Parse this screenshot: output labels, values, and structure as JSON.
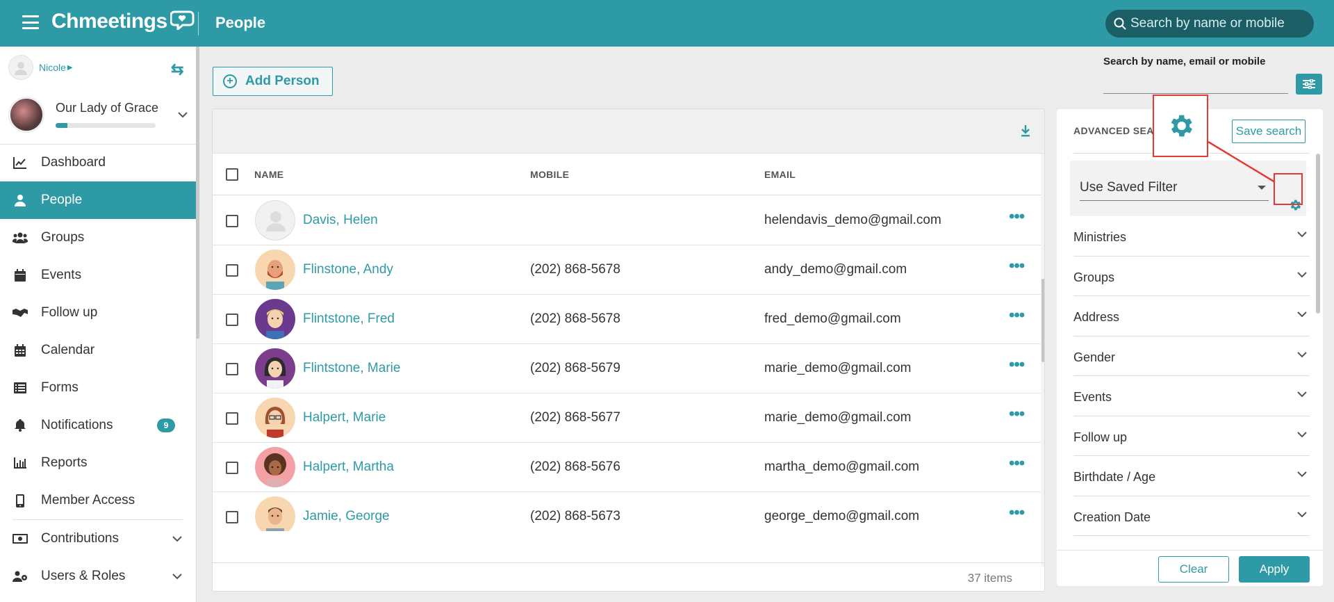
{
  "app": {
    "logo": "Chmeetings",
    "page_title": "People",
    "top_search_placeholder": "Search by name or mobile"
  },
  "sidebar": {
    "user_name": "Nicole",
    "org_name": "Our Lady of Grace",
    "org_progress": 0.12,
    "items": [
      {
        "label": "Dashboard",
        "icon": "chart-line-icon"
      },
      {
        "label": "People",
        "icon": "person-icon",
        "active": true
      },
      {
        "label": "Groups",
        "icon": "users-icon"
      },
      {
        "label": "Events",
        "icon": "calendar-icon"
      },
      {
        "label": "Follow up",
        "icon": "handshake-icon"
      },
      {
        "label": "Calendar",
        "icon": "calendar-grid-icon"
      },
      {
        "label": "Forms",
        "icon": "list-icon"
      },
      {
        "label": "Notifications",
        "icon": "bell-icon",
        "badge": "9"
      },
      {
        "label": "Reports",
        "icon": "bar-chart-icon"
      },
      {
        "label": "Member Access",
        "icon": "mobile-icon"
      },
      {
        "label": "Contributions",
        "icon": "money-icon"
      },
      {
        "label": "Users & Roles",
        "icon": "users-cog-icon"
      }
    ]
  },
  "toolbar": {
    "add_person_label": "Add Person"
  },
  "table": {
    "columns": [
      "NAME",
      "MOBILE",
      "EMAIL"
    ],
    "rows": [
      {
        "name": "Davis, Helen",
        "mobile": "",
        "email": "helendavis_demo@gmail.com",
        "avatar": "placeholder"
      },
      {
        "name": "Flinstone, Andy",
        "mobile": "(202) 868-5678",
        "email": "andy_demo@gmail.com",
        "avatar": "bearded-man"
      },
      {
        "name": "Flintstone, Fred",
        "mobile": "(202) 868-5678",
        "email": "fred_demo@gmail.com",
        "avatar": "blond-man"
      },
      {
        "name": "Flintstone, Marie",
        "mobile": "(202) 868-5679",
        "email": "marie_demo@gmail.com",
        "avatar": "dark-hair-woman"
      },
      {
        "name": "Halpert, Marie",
        "mobile": "(202) 868-5677",
        "email": "marie_demo@gmail.com",
        "avatar": "glasses-woman"
      },
      {
        "name": "Halpert, Martha",
        "mobile": "(202) 868-5676",
        "email": "martha_demo@gmail.com",
        "avatar": "curly-woman"
      },
      {
        "name": "Jamie, George",
        "mobile": "(202) 868-5673",
        "email": "george_demo@gmail.com",
        "avatar": "young-man"
      },
      {
        "name": "",
        "mobile": "",
        "email": "",
        "avatar": "red-hair-woman"
      }
    ],
    "item_count": "37 items"
  },
  "search_panel": {
    "label": "Search by name, email or mobile",
    "advanced_title": "ADVANCED SEA",
    "save_search_label": "Save search",
    "saved_filter_label": "Use Saved Filter",
    "filters": [
      "Ministries",
      "Groups",
      "Address",
      "Gender",
      "Events",
      "Follow up",
      "Birthdate / Age",
      "Creation Date"
    ],
    "clear_label": "Clear",
    "apply_label": "Apply"
  },
  "colors": {
    "brand": "#2e9aa6",
    "highlight": "#e53935"
  }
}
